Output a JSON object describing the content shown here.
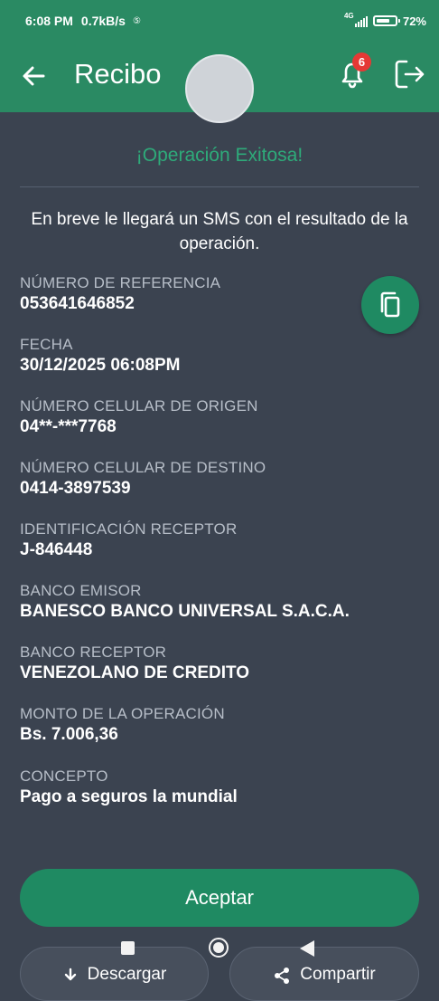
{
  "status_bar": {
    "time": "6:08 PM",
    "speed": "0.7kB/s",
    "network": "4G",
    "battery": "72%",
    "battery_level": 0.72
  },
  "app_bar": {
    "title": "Recibo",
    "notification_count": "6"
  },
  "receipt": {
    "success_title": "¡Operación Exitosa!",
    "message": "En breve le llegará un SMS con el resultado de la operación.",
    "fields": [
      {
        "label": "NÚMERO DE REFERENCIA",
        "value": "053641646852"
      },
      {
        "label": "FECHA",
        "value": "30/12/2025 06:08PM"
      },
      {
        "label": "NÚMERO CELULAR DE ORIGEN",
        "value": "04**-***7768"
      },
      {
        "label": "NÚMERO CELULAR DE DESTINO",
        "value": "0414-3897539"
      },
      {
        "label": "IDENTIFICACIÓN RECEPTOR",
        "value": "J-846448"
      },
      {
        "label": "BANCO EMISOR",
        "value": "BANESCO BANCO UNIVERSAL S.A.C.A."
      },
      {
        "label": "BANCO RECEPTOR",
        "value": "VENEZOLANO DE CREDITO"
      },
      {
        "label": "MONTO DE LA OPERACIÓN",
        "value": "Bs. 7.006,36"
      },
      {
        "label": "CONCEPTO",
        "value": "Pago a seguros la mundial"
      }
    ]
  },
  "buttons": {
    "accept": "Aceptar",
    "download": "Descargar",
    "share": "Compartir"
  },
  "colors": {
    "primary": "#2a8a63",
    "background": "#3b4350",
    "success_text": "#2eab7a",
    "badge": "#e53935"
  }
}
